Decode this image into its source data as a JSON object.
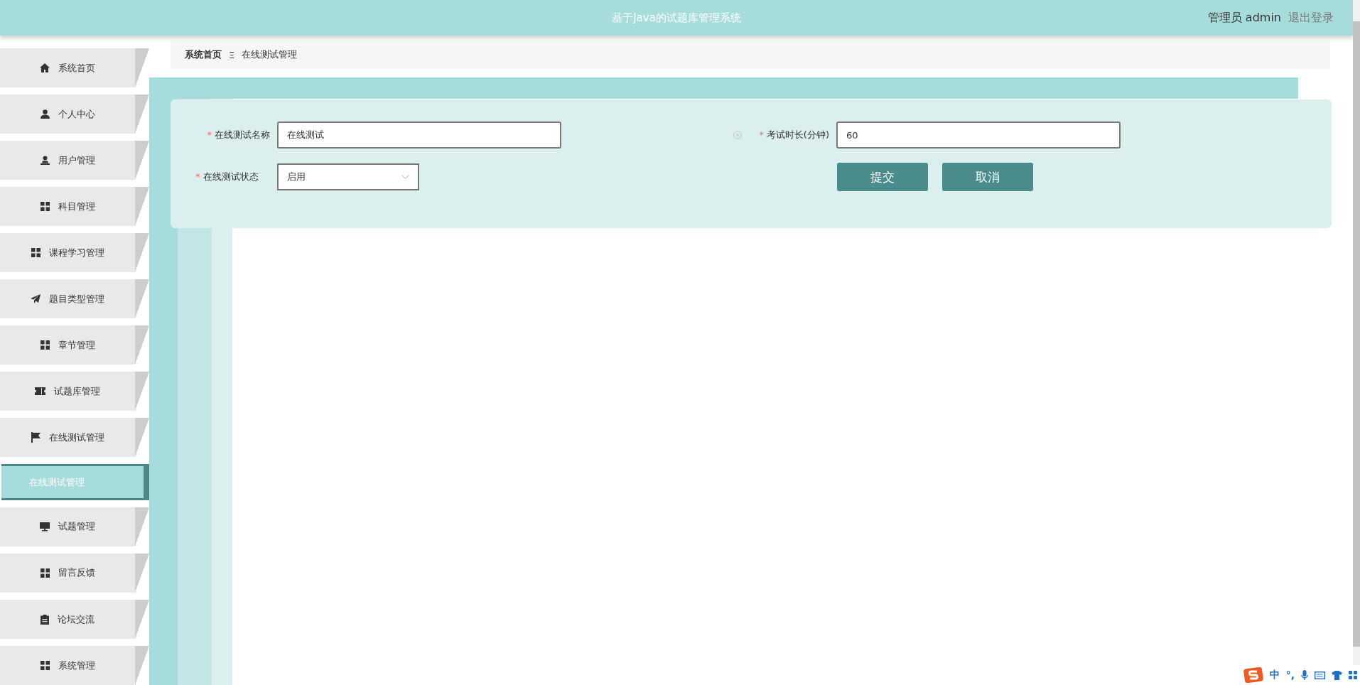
{
  "header": {
    "title": "基于Java的试题库管理系统",
    "user": "管理员 admin",
    "logout": "退出登录"
  },
  "sidebar": {
    "items": [
      {
        "label": "系统首页",
        "selected": false
      },
      {
        "label": "个人中心",
        "selected": false
      },
      {
        "label": "用户管理",
        "selected": false
      },
      {
        "label": "科目管理",
        "selected": false
      },
      {
        "label": "课程学习管理",
        "selected": false
      },
      {
        "label": "题目类型管理",
        "selected": false
      },
      {
        "label": "章节管理",
        "selected": false
      },
      {
        "label": "试题库管理",
        "selected": false
      },
      {
        "label": "在线测试管理",
        "selected": false,
        "children": [
          {
            "label": "在线测试管理",
            "selected": true
          }
        ]
      },
      {
        "label": "试题管理",
        "selected": false
      },
      {
        "label": "留言反馈",
        "selected": false
      },
      {
        "label": "论坛交流",
        "selected": false
      },
      {
        "label": "系统管理",
        "selected": false
      }
    ]
  },
  "breadcrumb": {
    "items": [
      "系统首页",
      "在线测试管理"
    ],
    "separator": "Ξ"
  },
  "form": {
    "fields": [
      {
        "kind": "text",
        "label": "在线测试名称",
        "required_mark": "*",
        "value": "在线测试"
      },
      {
        "kind": "text",
        "label": "考试时长(分钟)",
        "required_mark": "*",
        "value": "60",
        "clearable": true
      },
      {
        "kind": "select",
        "label": "在线测试状态",
        "required_mark": "*",
        "value": "启用"
      }
    ],
    "buttons": [
      "提交",
      "取消"
    ]
  },
  "ime_toolbar": {
    "items": [
      "中",
      "°,"
    ]
  }
}
